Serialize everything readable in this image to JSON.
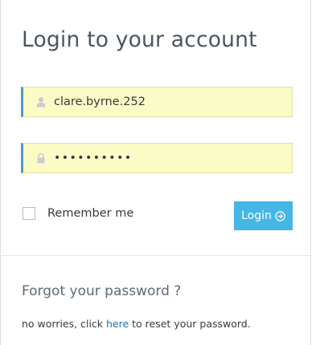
{
  "login": {
    "title": "Login to your account",
    "username": {
      "value": "clare.byrne.252",
      "icon": "user-icon"
    },
    "password": {
      "value": "••••••••••",
      "icon": "lock-icon"
    },
    "remember_label": "Remember me",
    "remember_checked": false,
    "login_button_label": "Login",
    "login_button_icon": "arrow-circle-right-icon",
    "colors": {
      "accent": "#45b6e6",
      "field_background": "#fbfbc5",
      "field_border_left": "#4a9bd4",
      "link": "#2a6fb0"
    }
  },
  "forgot": {
    "title": "Forgot your password ?",
    "text_before": "no worries, click ",
    "link_text": "here",
    "text_after": " to reset your password."
  }
}
